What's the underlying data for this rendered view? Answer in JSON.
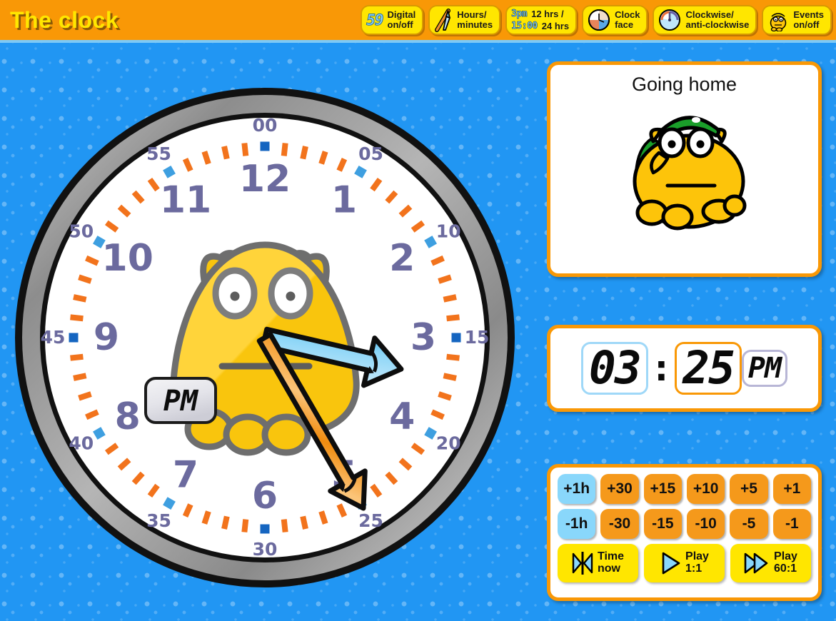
{
  "header": {
    "title": "The clock",
    "buttons": [
      {
        "id": "digital-onoff",
        "icon": "digital-59-icon",
        "icon_text": "59",
        "line1": "Digital",
        "line2": "on/off"
      },
      {
        "id": "hours-minutes",
        "icon": "hands-pencil-icon",
        "icon_text": "",
        "line1": "Hours/",
        "line2": "minutes"
      },
      {
        "id": "12-24-hrs",
        "icon": "time-format-icon",
        "icon_text": "",
        "line1": "12 hrs /",
        "line2": "24 hrs",
        "chip1": "3pm",
        "chip2": "15:00"
      },
      {
        "id": "clock-face",
        "icon": "clock-face-icon",
        "icon_text": "",
        "line1": "Clock",
        "line2": "face"
      },
      {
        "id": "clockwise",
        "icon": "gauge-icon",
        "icon_text": "",
        "line1": "Clockwise/",
        "line2": "anti-clockwise"
      },
      {
        "id": "events-onoff",
        "icon": "character-icon",
        "icon_text": "",
        "line1": "Events",
        "line2": "on/off"
      }
    ]
  },
  "event_panel": {
    "title": "Going home"
  },
  "digital": {
    "hours": "03",
    "colon": ":",
    "minutes": "25",
    "ampm": "PM"
  },
  "clock": {
    "ampm_badge": "PM",
    "hour_numbers": [
      "12",
      "1",
      "2",
      "3",
      "4",
      "5",
      "6",
      "7",
      "8",
      "9",
      "10",
      "11"
    ],
    "minute_numbers": [
      "00",
      "05",
      "10",
      "15",
      "20",
      "25",
      "30",
      "35",
      "40",
      "45",
      "50",
      "55"
    ],
    "hour_hand_value": 3,
    "minute_hand_value": 25,
    "hour_hand_angle": 103,
    "minute_hand_angle": 150,
    "colors": {
      "hour_hand": "#5bc0f0",
      "minute_hand": "#f99806",
      "numeral": "#6b6a9e",
      "minute_tick": "#f2731c",
      "marker_blue": "#1565c0",
      "bezel": "#9e9e9e",
      "face": "#ffffff"
    }
  },
  "controls": {
    "row_plus": [
      "+1h",
      "+30",
      "+15",
      "+10",
      "+5",
      "+1"
    ],
    "row_minus": [
      "-1h",
      "-30",
      "-15",
      "-10",
      "-5",
      "-1"
    ],
    "play_buttons": [
      {
        "id": "time-now",
        "icon": "time-now-icon",
        "line1": "Time",
        "line2": "now"
      },
      {
        "id": "play-1-1",
        "icon": "play-icon",
        "line1": "Play",
        "line2": "1:1"
      },
      {
        "id": "play-60-1",
        "icon": "fast-play-icon",
        "line1": "Play",
        "line2": "60:1"
      }
    ]
  },
  "theme": {
    "header_bg": "#f99806",
    "page_bg": "#2196f3",
    "accent_yellow": "#ffe600",
    "panel_border": "#f99806"
  }
}
